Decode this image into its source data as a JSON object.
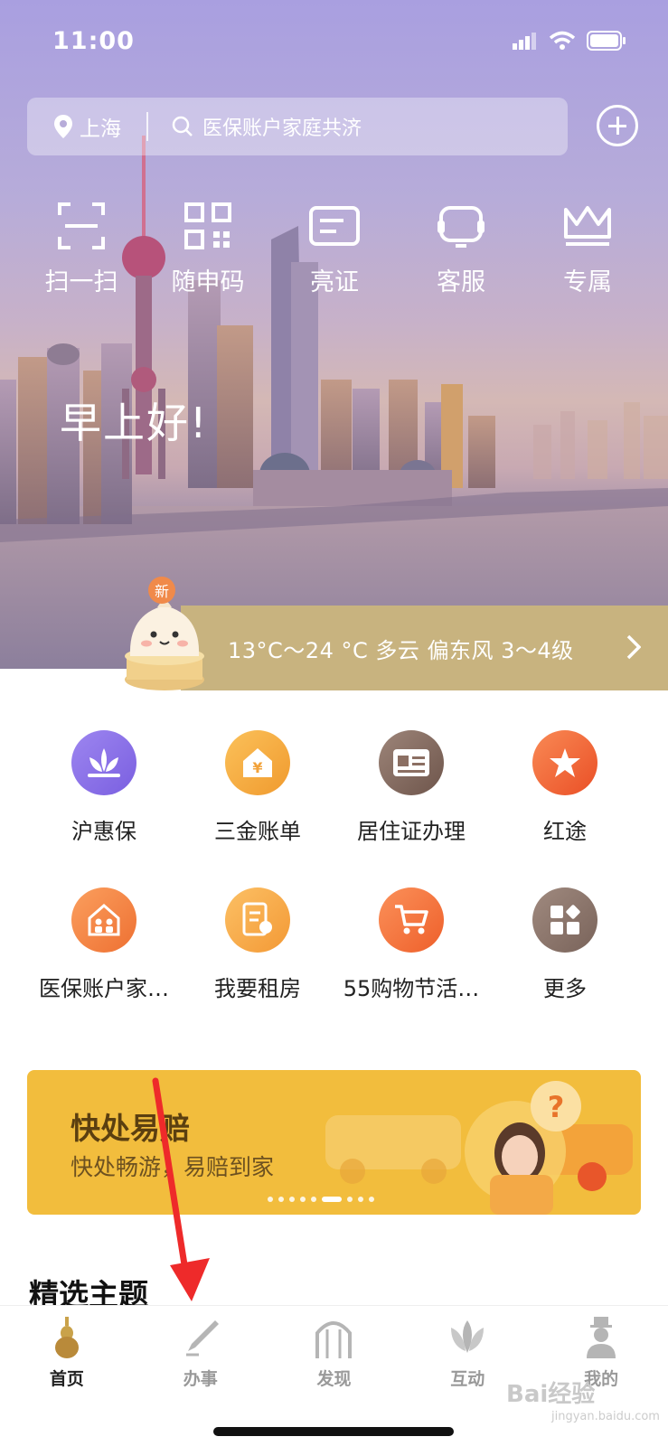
{
  "status": {
    "time": "11:00"
  },
  "search": {
    "location": "上海",
    "query": "医保账户家庭共济"
  },
  "quick_actions": [
    {
      "label": "扫一扫",
      "icon": "scan-icon"
    },
    {
      "label": "随申码",
      "icon": "qr-code-icon"
    },
    {
      "label": "亮证",
      "icon": "card-icon"
    },
    {
      "label": "客服",
      "icon": "customer-service-icon"
    },
    {
      "label": "专属",
      "icon": "crown-icon"
    }
  ],
  "greeting": "早上好!",
  "weather": {
    "badge": "新",
    "text": "13°C～24 °C 多云 偏东风 3～4级"
  },
  "services": [
    {
      "label": "沪惠保",
      "icon": "lotus-icon",
      "color": "#8a6de6"
    },
    {
      "label": "三金账单",
      "icon": "house-yen-icon",
      "color": "#f4a63a"
    },
    {
      "label": "居住证办理",
      "icon": "id-card-icon",
      "color": "#8b6f63"
    },
    {
      "label": "红途",
      "icon": "red-star-icon",
      "color": "#f06a35"
    },
    {
      "label": "医保账户家…",
      "icon": "family-house-icon",
      "color": "#f28a45"
    },
    {
      "label": "我要租房",
      "icon": "rent-doc-icon",
      "color": "#f6a945"
    },
    {
      "label": "55购物节活…",
      "icon": "cart-icon",
      "color": "#f4763a"
    },
    {
      "label": "更多",
      "icon": "grid-more-icon",
      "color": "#8d7468"
    }
  ],
  "banner": {
    "title": "快处易赔",
    "subtitle": "快处畅游，易赔到家",
    "dot_count": 9,
    "active_dot": 5
  },
  "section_title": "精选主题",
  "tabs": [
    {
      "label": "首页",
      "icon": "home-gourd-icon",
      "active": true
    },
    {
      "label": "办事",
      "icon": "pen-icon",
      "active": false
    },
    {
      "label": "发现",
      "icon": "arch-icon",
      "active": false
    },
    {
      "label": "互动",
      "icon": "flower-icon",
      "active": false
    },
    {
      "label": "我的",
      "icon": "person-icon",
      "active": false
    }
  ],
  "watermark": {
    "text": "Bai经验",
    "sub": "jingyan.baidu.com"
  }
}
